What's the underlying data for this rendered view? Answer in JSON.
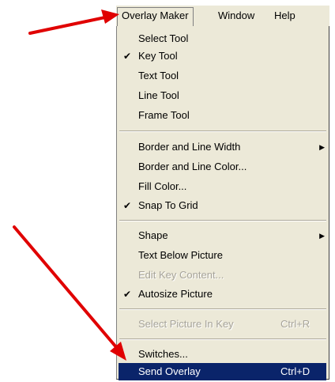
{
  "menubar": {
    "items": [
      "Overlay Maker",
      "Window",
      "Help"
    ]
  },
  "menu": {
    "items": [
      {
        "label": "Select Tool"
      },
      {
        "label": "Key Tool",
        "checked": true
      },
      {
        "label": "Text Tool"
      },
      {
        "label": "Line Tool"
      },
      {
        "label": "Frame Tool"
      },
      {
        "label": "Border and Line Width",
        "submenu": true
      },
      {
        "label": "Border and Line Color..."
      },
      {
        "label": "Fill Color..."
      },
      {
        "label": "Snap To Grid",
        "checked": true
      },
      {
        "label": "Shape",
        "submenu": true
      },
      {
        "label": "Text Below Picture"
      },
      {
        "label": "Edit Key Content...",
        "disabled": true
      },
      {
        "label": "Autosize Picture",
        "checked": true
      },
      {
        "label": "Select Picture In Key",
        "shortcut": "Ctrl+R",
        "disabled": true
      },
      {
        "label": "Switches..."
      },
      {
        "label": "Send Overlay",
        "shortcut": "Ctrl+D",
        "highlighted": true
      }
    ]
  },
  "glyphs": {
    "check": "✔",
    "submenu_arrow": "▶"
  },
  "colors": {
    "highlight": "#0a246a",
    "arrow": "#e00000"
  }
}
